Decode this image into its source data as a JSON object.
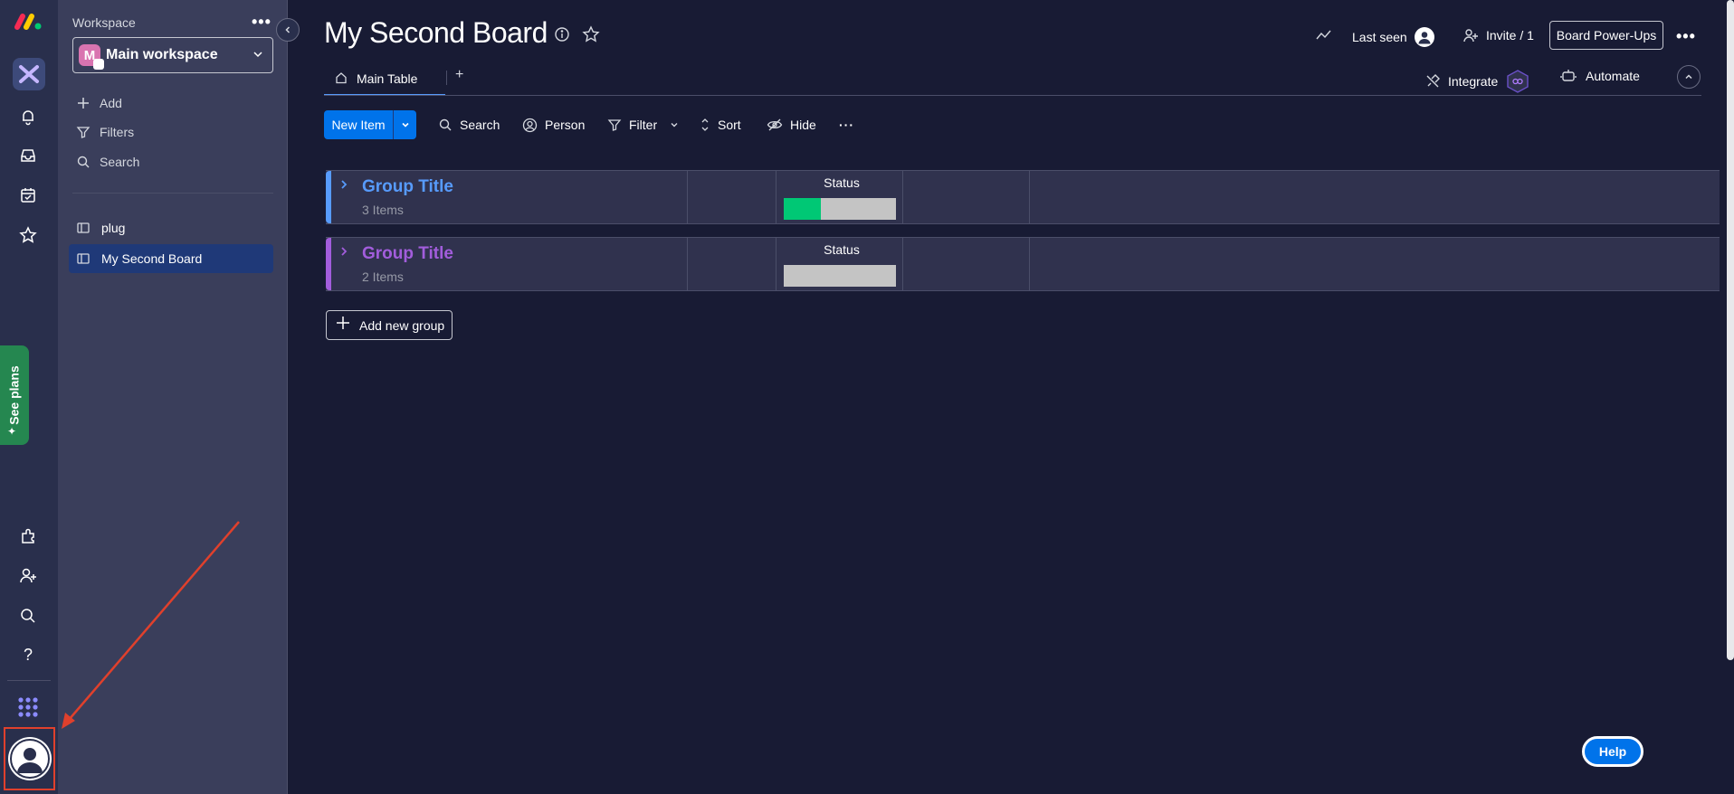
{
  "workspace": {
    "label": "Workspace",
    "more": "•••",
    "selected_initial": "M",
    "selected_name": "Main workspace"
  },
  "sidebar": {
    "actions": [
      {
        "label": "Add",
        "icon": "plus-icon"
      },
      {
        "label": "Filters",
        "icon": "filter-icon"
      },
      {
        "label": "Search",
        "icon": "search-icon"
      }
    ],
    "boards": [
      {
        "label": "plug",
        "icon": "board-icon",
        "active": false
      },
      {
        "label": "My Second Board",
        "icon": "board-icon",
        "active": true
      }
    ]
  },
  "rail": {
    "see_plans": "See plans",
    "icons": [
      "notifications-icon",
      "inbox-icon",
      "my-work-icon",
      "favorites-icon",
      "apps-icon",
      "invite-icon",
      "search-icon",
      "help-icon",
      "product-switcher-icon"
    ]
  },
  "header": {
    "title": "My Second Board",
    "last_seen": "Last seen",
    "invite": "Invite / 1",
    "power_ups": "Board Power-Ups",
    "integrate": "Integrate",
    "automate": "Automate"
  },
  "tabs": {
    "main_table": "Main Table",
    "add": "+"
  },
  "toolbar": {
    "new_item": "New Item",
    "search": "Search",
    "person": "Person",
    "filter": "Filter",
    "sort": "Sort",
    "hide": "Hide",
    "more": "···"
  },
  "groups": [
    {
      "title": "Group Title",
      "count": "3 Items",
      "color": "#579bfc",
      "status_label": "Status",
      "done_fraction": 0.33
    },
    {
      "title": "Group Title",
      "count": "2 Items",
      "color": "#a25ddc",
      "status_label": "Status",
      "done_fraction": 0
    }
  ],
  "add_group": "Add new group",
  "help": "Help",
  "colors": {
    "primary": "#0073ea",
    "done": "#00c875",
    "see_plans": "#258750",
    "highlight": "#e0402c"
  }
}
